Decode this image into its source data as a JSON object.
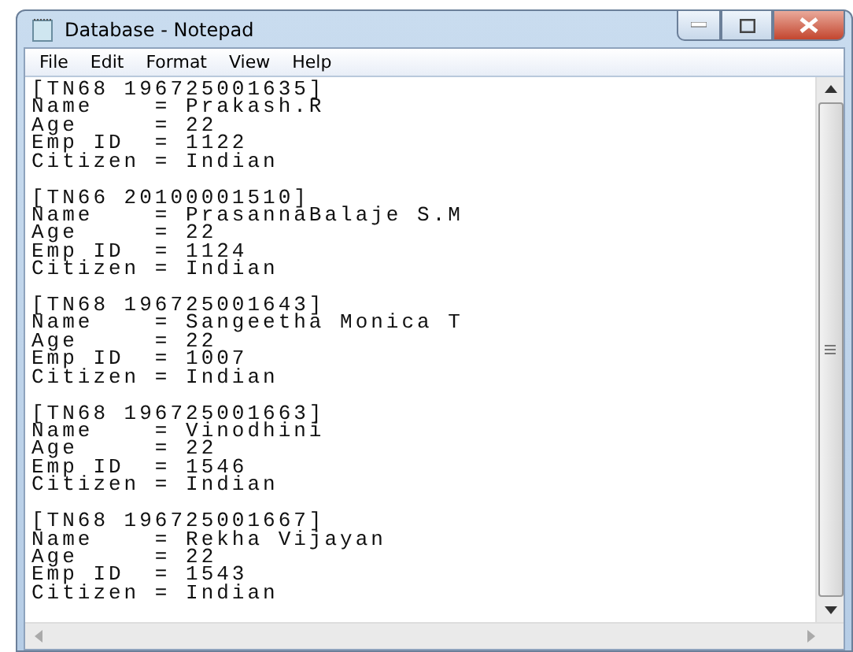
{
  "window": {
    "title": "Database - Notepad"
  },
  "menu": [
    "File",
    "Edit",
    "Format",
    "View",
    "Help"
  ],
  "records": [
    {
      "header": "[TN68 196725001635]",
      "lines": [
        "Name    = Prakash.R",
        "Age     = 22",
        "Emp ID  = 1122",
        "Citizen = Indian"
      ]
    },
    {
      "header": "[TN66 20100001510]",
      "lines": [
        "Name    = PrasannaBalaje S.M",
        "Age     = 22",
        "Emp ID  = 1124",
        "Citizen = Indian"
      ]
    },
    {
      "header": "[TN68 196725001643]",
      "lines": [
        "Name    = Sangeetha Monica T",
        "Age     = 22",
        "Emp ID  = 1007",
        "Citizen = Indian"
      ]
    },
    {
      "header": "[TN68 196725001663]",
      "lines": [
        "Name    = Vinodhini",
        "Age     = 22",
        "Emp ID  = 1546",
        "Citizen = Indian"
      ]
    },
    {
      "header": "[TN68 196725001667]",
      "lines": [
        "Name    = Rekha Vijayan",
        "Age     = 22",
        "Emp ID  = 1543",
        "Citizen = Indian"
      ]
    }
  ]
}
